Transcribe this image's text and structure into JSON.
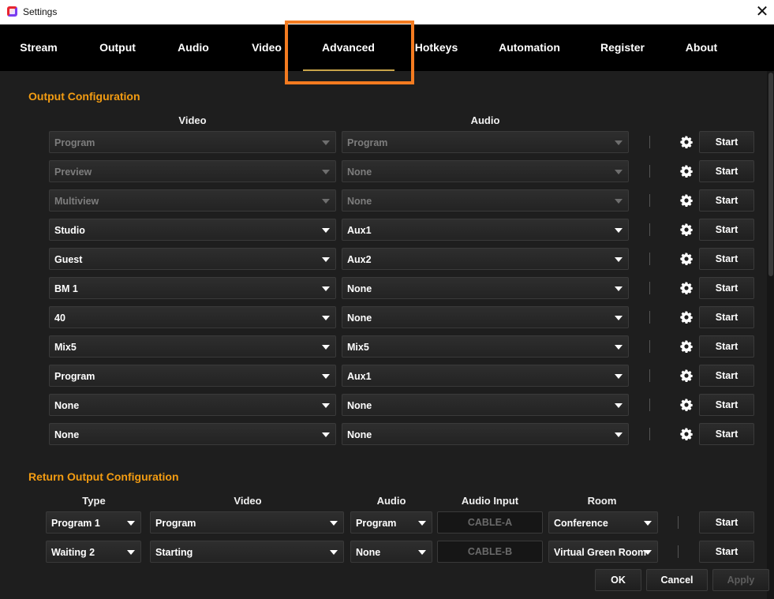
{
  "window": {
    "title": "Settings",
    "close_glyph": "✕"
  },
  "tabs": [
    {
      "label": "Stream"
    },
    {
      "label": "Output"
    },
    {
      "label": "Audio"
    },
    {
      "label": "Video"
    },
    {
      "label": "Advanced",
      "active": true
    },
    {
      "label": "Hotkeys"
    },
    {
      "label": "Automation"
    },
    {
      "label": "Register"
    },
    {
      "label": "About"
    }
  ],
  "output_config": {
    "title": "Output Configuration",
    "headers": {
      "video": "Video",
      "audio": "Audio"
    },
    "rows": [
      {
        "video": "Program",
        "audio": "Program",
        "disabled": true,
        "button": "Start"
      },
      {
        "video": "Preview",
        "audio": "None",
        "disabled": true,
        "button": "Start"
      },
      {
        "video": "Multiview",
        "audio": "None",
        "disabled": true,
        "button": "Start"
      },
      {
        "video": "Studio",
        "audio": "Aux1",
        "disabled": false,
        "button": "Start"
      },
      {
        "video": "Guest",
        "audio": "Aux2",
        "disabled": false,
        "button": "Start"
      },
      {
        "video": "BM 1",
        "audio": "None",
        "disabled": false,
        "button": "Start"
      },
      {
        "video": "40",
        "audio": "None",
        "disabled": false,
        "button": "Start"
      },
      {
        "video": "Mix5",
        "audio": "Mix5",
        "disabled": false,
        "button": "Start"
      },
      {
        "video": "Program",
        "audio": "Aux1",
        "disabled": false,
        "button": "Start"
      },
      {
        "video": "None",
        "audio": "None",
        "disabled": false,
        "button": "Start"
      },
      {
        "video": "None",
        "audio": "None",
        "disabled": false,
        "button": "Start"
      }
    ]
  },
  "return_config": {
    "title": "Return Output Configuration",
    "headers": {
      "type": "Type",
      "video": "Video",
      "audio": "Audio",
      "audio_input": "Audio Input",
      "room": "Room"
    },
    "rows": [
      {
        "type": "Program 1",
        "video": "Program",
        "audio": "Program",
        "audio_input": "CABLE-A",
        "room": "Conference",
        "button": "Start"
      },
      {
        "type": "Waiting 2",
        "video": "Starting",
        "audio": "None",
        "audio_input": "CABLE-B",
        "room": "Virtual Green Room",
        "button": "Start"
      }
    ]
  },
  "footer": {
    "ok": "OK",
    "cancel": "Cancel",
    "apply": "Apply"
  },
  "colors": {
    "accent_orange": "#f39c12",
    "highlight_box": "#f47b20",
    "tab_bar": "#000000",
    "panel": "#1e1e1e"
  },
  "icons": {
    "settings_row_icon": "gear-icon",
    "dropdown_icon": "caret-down-icon",
    "close": "close-icon"
  }
}
